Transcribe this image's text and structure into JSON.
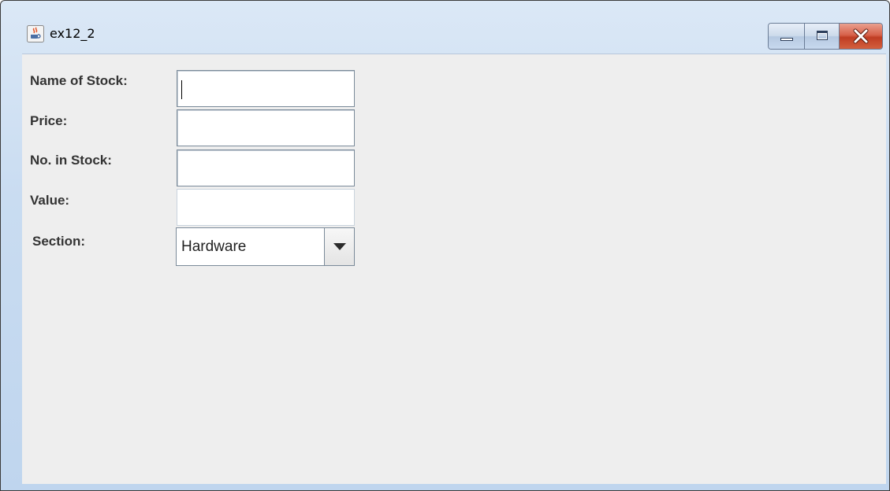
{
  "window": {
    "title": "ex12_2",
    "icon": "java-coffee-icon"
  },
  "caption_buttons": {
    "minimize_icon": "minimize-icon",
    "maximize_icon": "maximize-icon",
    "close_icon": "close-icon",
    "close_color": "#c7432a"
  },
  "form": {
    "name_label": "Name of Stock:",
    "name_value": "",
    "price_label": "Price:",
    "price_value": "",
    "count_label": "No. in Stock:",
    "count_value": "",
    "value_label": "Value:",
    "value_value": "",
    "section_label": "Section:",
    "section_selected": "Hardware",
    "section_arrow_icon": "chevron-down-icon"
  },
  "colors": {
    "content_background": "#eeeeee",
    "titlebar_tint": "#c9dcf1",
    "label_text": "#333333"
  }
}
